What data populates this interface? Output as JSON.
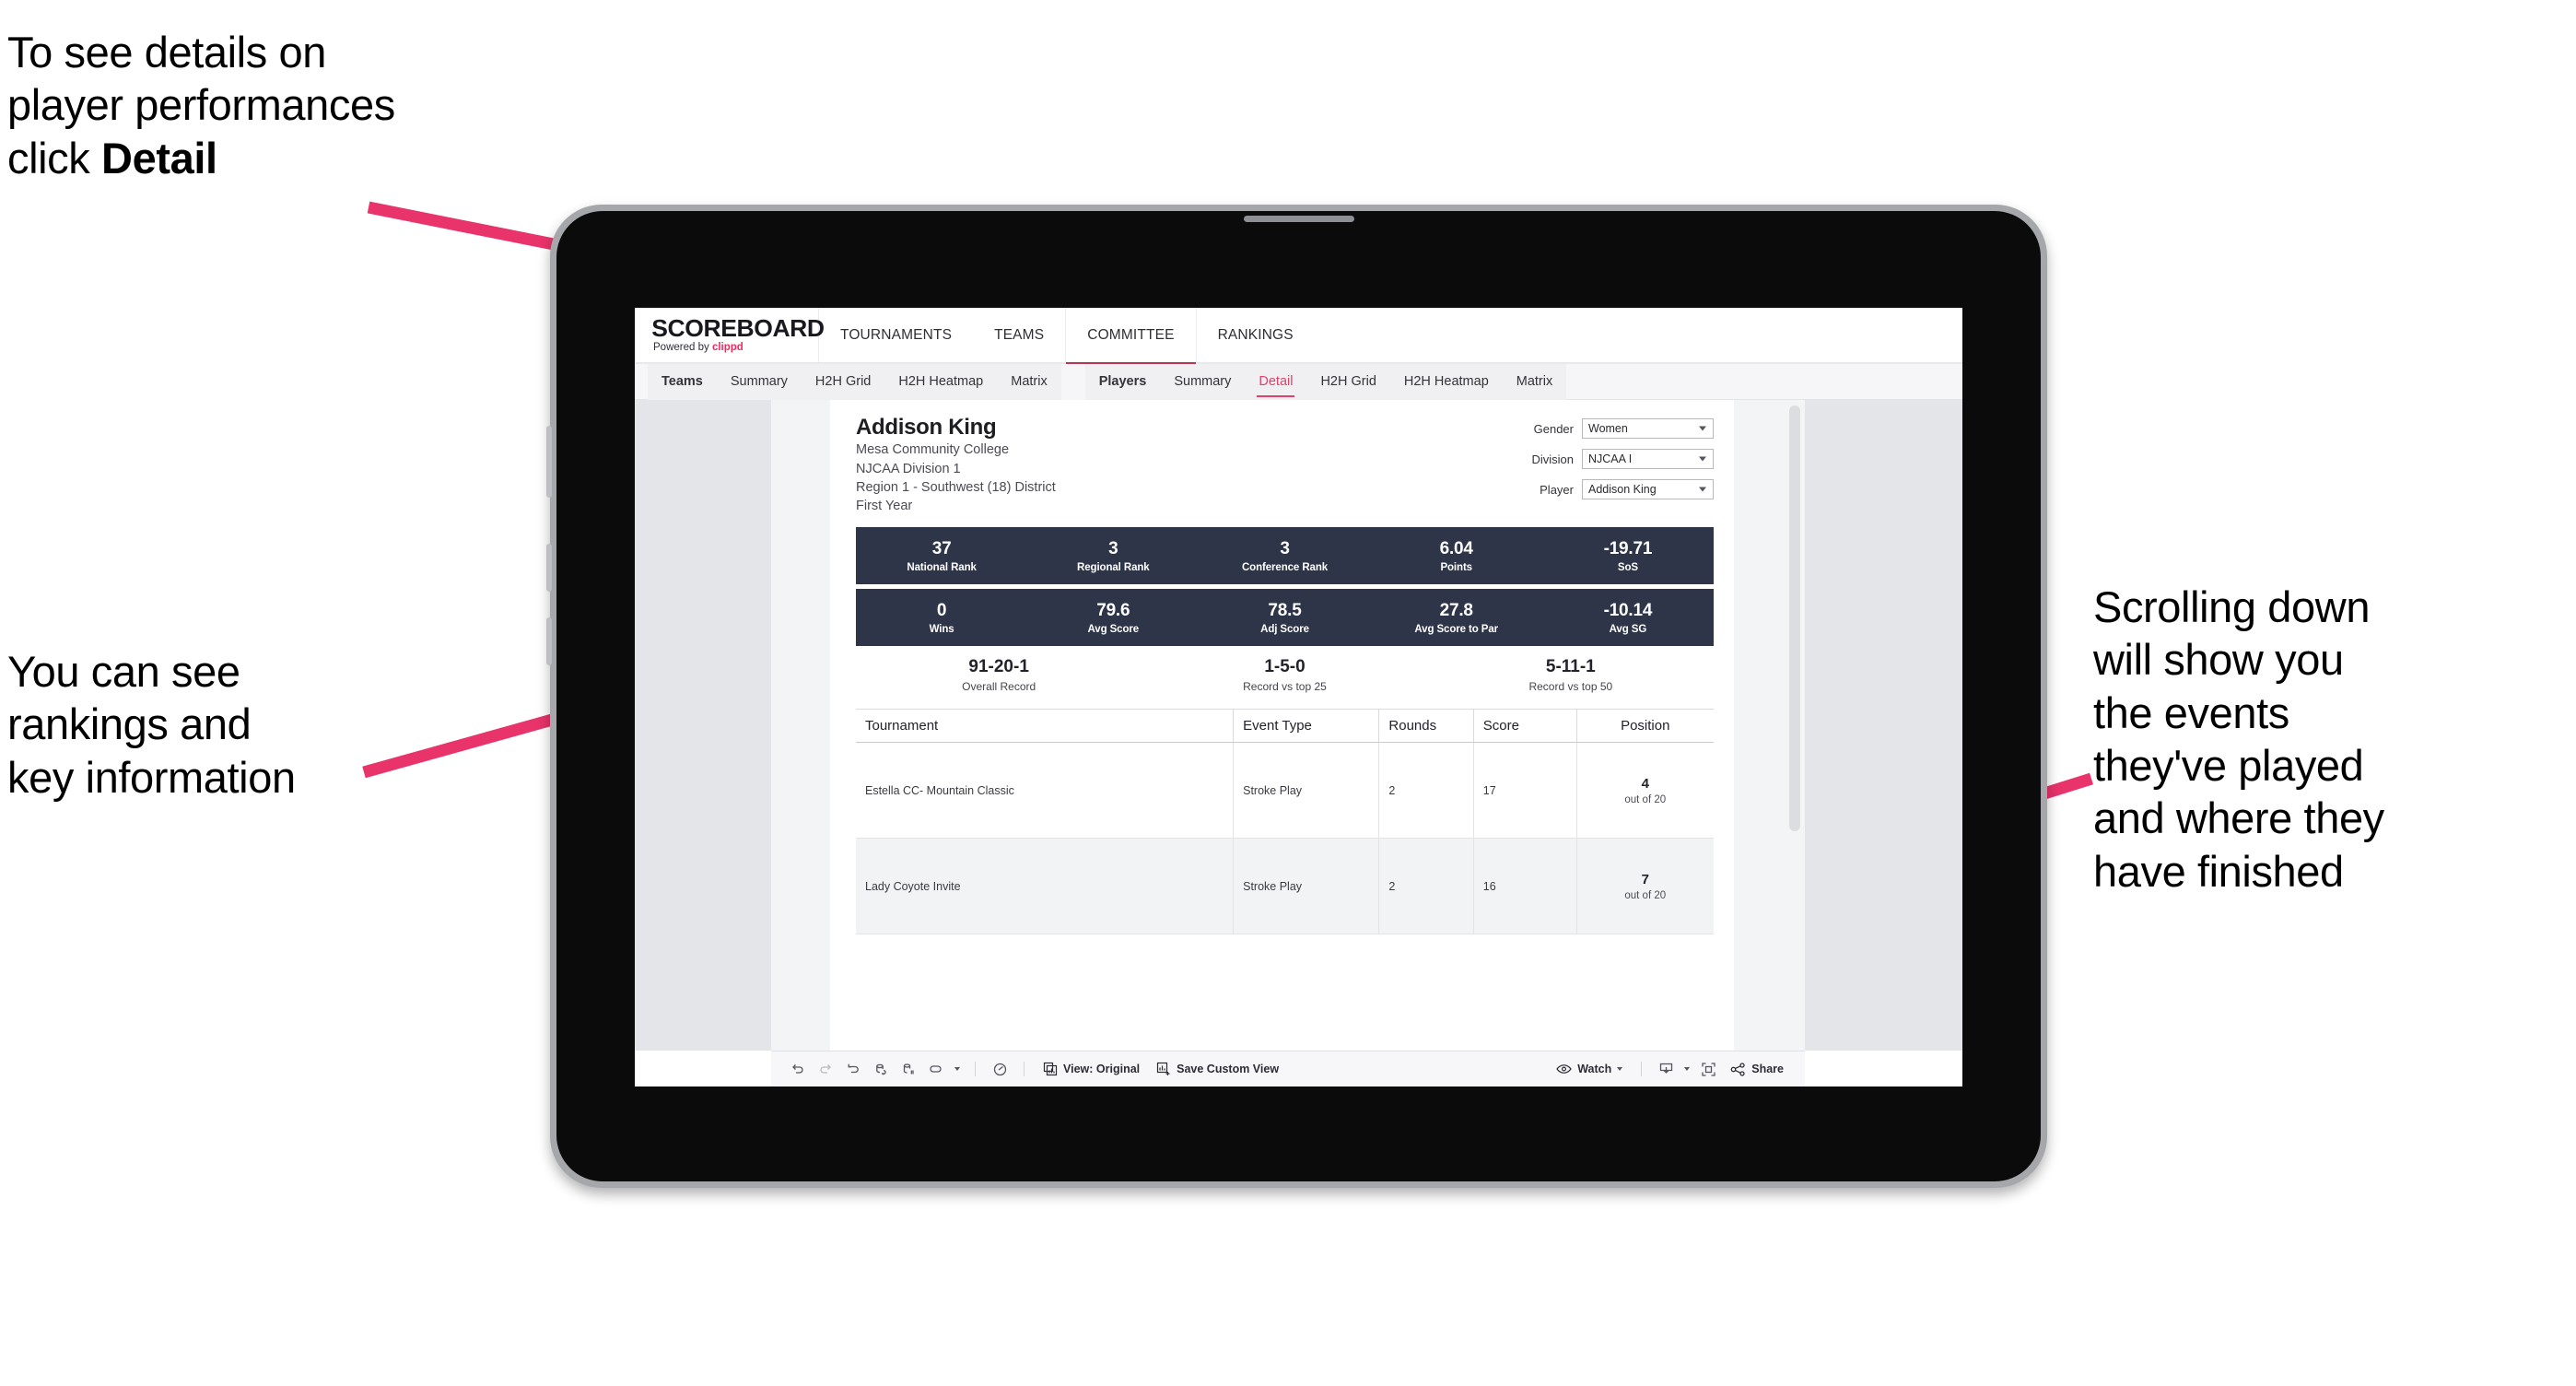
{
  "annotations": {
    "top_left": "To see details on\nplayer performances\nclick ",
    "top_left_bold": "Detail",
    "mid_left": "You can see\nrankings and\nkey information",
    "right": "Scrolling down\nwill show you\nthe events\nthey've played\nand where they\nhave finished"
  },
  "colors": {
    "accent_pink": "#ef2a5f",
    "arrow_pink": "#e8336b",
    "band_navy": "#2e3548",
    "active_tab": "#e0416a"
  },
  "header": {
    "logo_main": "SCOREBOARD",
    "logo_sub_prefix": "Powered by ",
    "logo_sub_brand": "clippd",
    "nav": [
      {
        "label": "TOURNAMENTS"
      },
      {
        "label": "TEAMS"
      },
      {
        "label": "COMMITTEE"
      },
      {
        "label": "RANKINGS"
      }
    ]
  },
  "subtabs": {
    "teams_group": [
      "Teams",
      "Summary",
      "H2H Grid",
      "H2H Heatmap",
      "Matrix"
    ],
    "players_group": [
      "Players",
      "Summary",
      "Detail",
      "H2H Grid",
      "H2H Heatmap",
      "Matrix"
    ],
    "active": "Detail"
  },
  "player": {
    "name": "Addison King",
    "school": "Mesa Community College",
    "division": "NJCAA Division 1",
    "region": "Region 1 - Southwest (18) District",
    "year": "First Year"
  },
  "filters": [
    {
      "label": "Gender",
      "value": "Women"
    },
    {
      "label": "Division",
      "value": "NJCAA I"
    },
    {
      "label": "Player",
      "value": "Addison King"
    }
  ],
  "stats_band_1": [
    {
      "value": "37",
      "label": "National Rank"
    },
    {
      "value": "3",
      "label": "Regional Rank"
    },
    {
      "value": "3",
      "label": "Conference Rank"
    },
    {
      "value": "6.04",
      "label": "Points"
    },
    {
      "value": "-19.71",
      "label": "SoS"
    }
  ],
  "stats_band_2": [
    {
      "value": "0",
      "label": "Wins"
    },
    {
      "value": "79.6",
      "label": "Avg Score"
    },
    {
      "value": "78.5",
      "label": "Adj Score"
    },
    {
      "value": "27.8",
      "label": "Avg Score to Par"
    },
    {
      "value": "-10.14",
      "label": "Avg SG"
    }
  ],
  "records": [
    {
      "value": "91-20-1",
      "label": "Overall Record"
    },
    {
      "value": "1-5-0",
      "label": "Record vs top 25"
    },
    {
      "value": "5-11-1",
      "label": "Record vs top 50"
    }
  ],
  "table": {
    "headers": [
      "Tournament",
      "Event Type",
      "Rounds",
      "Score",
      "Position"
    ],
    "rows": [
      {
        "tournament": "Estella CC- Mountain Classic",
        "event_type": "Stroke Play",
        "rounds": "2",
        "score": "17",
        "position": "4",
        "position_sub": "out of 20"
      },
      {
        "tournament": "Lady Coyote Invite",
        "event_type": "Stroke Play",
        "rounds": "2",
        "score": "16",
        "position": "7",
        "position_sub": "out of 20"
      }
    ]
  },
  "toolbar": {
    "view_label": "View: Original",
    "save_label": "Save Custom View",
    "watch_label": "Watch",
    "share_label": "Share"
  }
}
